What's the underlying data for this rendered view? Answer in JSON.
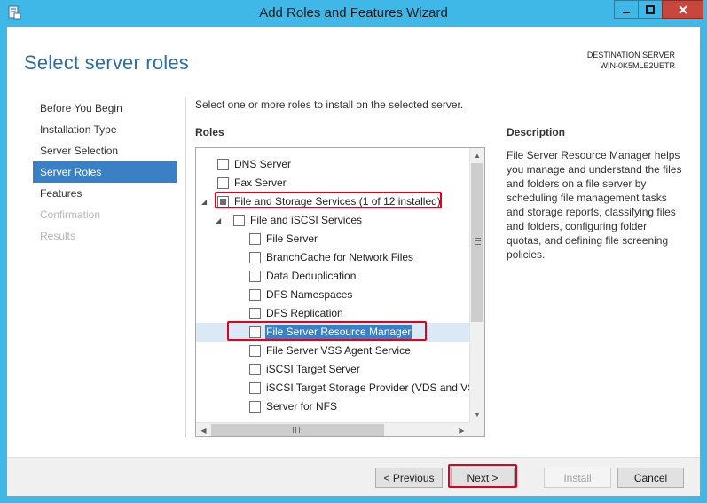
{
  "window": {
    "title": "Add Roles and Features Wizard"
  },
  "header": {
    "page_title": "Select server roles",
    "destination_label": "DESTINATION SERVER",
    "destination_server": "WIN-0K5MLE2UETR"
  },
  "nav": {
    "items": [
      {
        "label": "Before You Begin",
        "state": "normal"
      },
      {
        "label": "Installation Type",
        "state": "normal"
      },
      {
        "label": "Server Selection",
        "state": "normal"
      },
      {
        "label": "Server Roles",
        "state": "active"
      },
      {
        "label": "Features",
        "state": "normal"
      },
      {
        "label": "Confirmation",
        "state": "disabled"
      },
      {
        "label": "Results",
        "state": "disabled"
      }
    ]
  },
  "main": {
    "instruction": "Select one or more roles to install on the selected server.",
    "roles_heading": "Roles",
    "description_heading": "Description",
    "description_text": "File Server Resource Manager helps you manage and understand the files and folders on a file server by scheduling file management tasks and storage reports, classifying files and folders, configuring folder quotas, and defining file screening policies."
  },
  "roles_tree": {
    "items": [
      {
        "label": "DNS Server",
        "checked": false
      },
      {
        "label": "Fax Server",
        "checked": false
      },
      {
        "label": "File and Storage Services (1 of 12 installed)",
        "checked": "partial",
        "expanded": true
      },
      {
        "label": "File and iSCSI Services",
        "checked": false,
        "expanded": true
      },
      {
        "label": "File Server",
        "checked": false
      },
      {
        "label": "BranchCache for Network Files",
        "checked": false
      },
      {
        "label": "Data Deduplication",
        "checked": false
      },
      {
        "label": "DFS Namespaces",
        "checked": false
      },
      {
        "label": "DFS Replication",
        "checked": false
      },
      {
        "label": "File Server Resource Manager",
        "checked": false,
        "selected": true
      },
      {
        "label": "File Server VSS Agent Service",
        "checked": false
      },
      {
        "label": "iSCSI Target Server",
        "checked": false
      },
      {
        "label": "iSCSI Target Storage Provider (VDS and VSS",
        "checked": false
      },
      {
        "label": "Server for NFS",
        "checked": false
      }
    ]
  },
  "footer": {
    "previous_label": "< Previous",
    "next_label": "Next >",
    "install_label": "Install",
    "cancel_label": "Cancel"
  },
  "colors": {
    "titlebar": "#3fb8e8",
    "accent": "#3a80c4",
    "page_title": "#2b6ea3",
    "highlight": "#e2001a"
  },
  "icons": {
    "app": "server-manager-icon",
    "minimize": "minimize-icon",
    "maximize": "maximize-icon",
    "close": "close-icon"
  }
}
